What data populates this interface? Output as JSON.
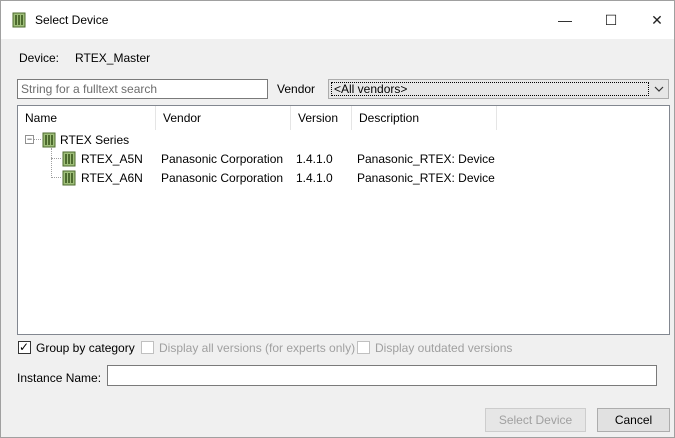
{
  "window": {
    "title": "Select Device",
    "controls": {
      "minimize": "—",
      "maximize": "☐",
      "close": "✕"
    }
  },
  "device": {
    "label": "Device:",
    "value": "RTEX_Master"
  },
  "search": {
    "placeholder": "String for a fulltext search",
    "value": ""
  },
  "vendor": {
    "label": "Vendor",
    "selected": "<All vendors>"
  },
  "tree": {
    "columns": [
      "Name",
      "Vendor",
      "Version",
      "Description"
    ],
    "group": {
      "label": "RTEX Series",
      "expander": "−"
    },
    "rows": [
      {
        "name": "RTEX_A5N",
        "vendor": "Panasonic Corporation",
        "version": "1.4.1.0",
        "description": "Panasonic_RTEX: Device"
      },
      {
        "name": "RTEX_A6N",
        "vendor": "Panasonic Corporation",
        "version": "1.4.1.0",
        "description": "Panasonic_RTEX: Device"
      }
    ]
  },
  "options": {
    "group_by_category": {
      "label": "Group by category",
      "checked": true,
      "mark": "✓"
    },
    "display_all_versions": {
      "label": "Display all versions (for experts only)",
      "checked": false
    },
    "display_outdated": {
      "label": "Display outdated versions",
      "checked": false
    }
  },
  "instance": {
    "label": "Instance Name:",
    "value": ""
  },
  "buttons": {
    "select": "Select Device",
    "cancel": "Cancel"
  },
  "icons": {
    "device": "device-module-icon",
    "dropdown": "chevron-down-icon"
  }
}
